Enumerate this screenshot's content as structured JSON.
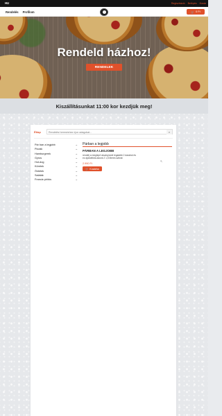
{
  "topbar": {
    "language": "HU",
    "links": [
      "Regisztráció",
      "Belépés",
      "Kosár"
    ]
  },
  "nav": {
    "links": [
      "Rendelés",
      "Profilom"
    ],
    "cart_label": "0 Ft"
  },
  "hero": {
    "title": "Rendeld házhoz!",
    "button_label": "RENDELEK"
  },
  "banner": {
    "text": "Kiszállításunkat 11:00 kor kezdjük meg!"
  },
  "search": {
    "label": "Étlap",
    "placeholder": "Rendelési kereséshez írjon adagokat..."
  },
  "categories": [
    {
      "label": "Pár ban a legjobb"
    },
    {
      "label": "Pizzák"
    },
    {
      "label": "Hamburgerek"
    },
    {
      "label": "Gyros"
    },
    {
      "label": "Hot-dog"
    },
    {
      "label": "Köretek"
    },
    {
      "label": "Öntetek"
    },
    {
      "label": "Saláták"
    },
    {
      "label": "Francia pirítós"
    }
  ],
  "section": {
    "title": "Párban a legjobb",
    "product": {
      "name": "PÁRBAN A LEGJOBB",
      "description": "rendelj a meglepő ásványvizet legalább 2 darabot és ez ajándékba adunk 2 1,5 literes szilvát",
      "price": "2.990 Ft",
      "add_label": "Kosárba"
    }
  },
  "colors": {
    "accent": "#e0512b",
    "topbar": "#141414",
    "banner": "#dcdfe3"
  }
}
